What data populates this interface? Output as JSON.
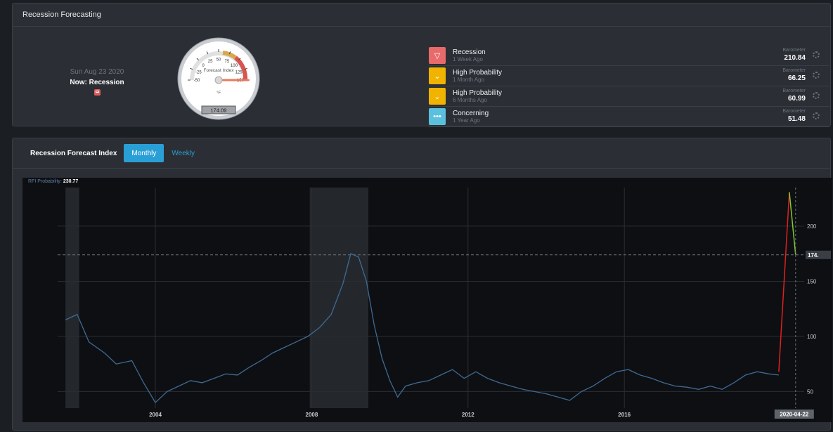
{
  "top_panel": {
    "title": "Recession Forecasting"
  },
  "current": {
    "date": "Sun Aug 23 2020",
    "now_label": "Now: Recession",
    "now_icon": "thumbs-down-icon"
  },
  "gauge": {
    "title": "Forecast Index",
    "unit": "°F",
    "reading": "174.09",
    "value": 174.09,
    "ticks": [
      "-50",
      "-25",
      "0",
      "25",
      "50",
      "75",
      "100",
      "125",
      "150"
    ],
    "band_colors": {
      "warning": "#d9a84e",
      "danger": "#d9534f"
    }
  },
  "barometers": [
    {
      "status": "Recession",
      "time": "1 Week Ago",
      "label": "Barometer",
      "value": "210.84",
      "icon": "thumbs-down-icon",
      "color": "#e86a6a"
    },
    {
      "status": "High Probability",
      "time": "1 Month Ago",
      "label": "Barometer",
      "value": "66.25",
      "icon": "chevron-down-icon",
      "color": "#f0b400"
    },
    {
      "status": "High Probability",
      "time": "6 Months Ago",
      "label": "Barometer",
      "value": "60.99",
      "icon": "chevron-down-icon",
      "color": "#f0b400"
    },
    {
      "status": "Concerning",
      "time": "1 Year Ago",
      "label": "Barometer",
      "value": "51.48",
      "icon": "ellipsis-icon",
      "color": "#5bc0de"
    }
  ],
  "index_panel": {
    "title": "Recession Forecast Index",
    "tabs": [
      {
        "label": "Monthly",
        "active": true
      },
      {
        "label": "Weekly",
        "active": false
      }
    ]
  },
  "chart_data": {
    "type": "line",
    "series_label": "RFI Probability:",
    "series_value": "230.77",
    "x_ticks": [
      "2004",
      "2008",
      "2012",
      "2016"
    ],
    "y_ticks": [
      "50",
      "100",
      "150",
      "200"
    ],
    "current_value_label": "174.",
    "date_label": "2020-04-22",
    "xlim": [
      2001.5,
      2020.6
    ],
    "ylim": [
      35,
      235
    ],
    "recession_bands": [
      [
        2001.7,
        2002.05
      ],
      [
        2007.95,
        2009.45
      ]
    ],
    "reference_line": 174,
    "series": [
      {
        "x": [
          2001.7,
          2002.0,
          2002.3,
          2002.7,
          2003.0,
          2003.4,
          2003.7,
          2004.0,
          2004.3,
          2004.6,
          2004.9,
          2005.2,
          2005.5,
          2005.8,
          2006.1,
          2006.4,
          2006.7,
          2007.0,
          2007.3,
          2007.6,
          2007.9,
          2008.2,
          2008.5,
          2008.8,
          2009.0,
          2009.2,
          2009.4,
          2009.6,
          2009.8,
          2010.0,
          2010.2,
          2010.4,
          2010.7,
          2011.0,
          2011.3,
          2011.6,
          2011.9,
          2012.2,
          2012.5,
          2012.8,
          2013.1,
          2013.4,
          2013.7,
          2014.0,
          2014.3,
          2014.6,
          2014.9,
          2015.2,
          2015.5,
          2015.8,
          2016.1,
          2016.4,
          2016.7,
          2017.0,
          2017.3,
          2017.6,
          2017.9,
          2018.2,
          2018.5,
          2018.8,
          2019.1,
          2019.4,
          2019.7,
          2019.95
        ],
        "y": [
          115,
          120,
          95,
          85,
          75,
          78,
          58,
          40,
          50,
          55,
          60,
          58,
          62,
          66,
          65,
          72,
          78,
          85,
          90,
          95,
          100,
          108,
          120,
          148,
          175,
          172,
          150,
          110,
          80,
          60,
          45,
          55,
          58,
          60,
          65,
          70,
          62,
          68,
          62,
          58,
          55,
          52,
          50,
          48,
          45,
          42,
          50,
          55,
          62,
          68,
          70,
          65,
          62,
          58,
          55,
          54,
          52,
          55,
          52,
          58,
          65,
          68,
          66,
          65
        ],
        "color": "#3e6a95"
      }
    ],
    "spike": {
      "x": [
        2019.95,
        2020.22,
        2020.38
      ],
      "y": [
        68,
        230.77,
        174.09
      ],
      "up_color": "#e02020",
      "down_color": "#7ecb2e"
    }
  }
}
